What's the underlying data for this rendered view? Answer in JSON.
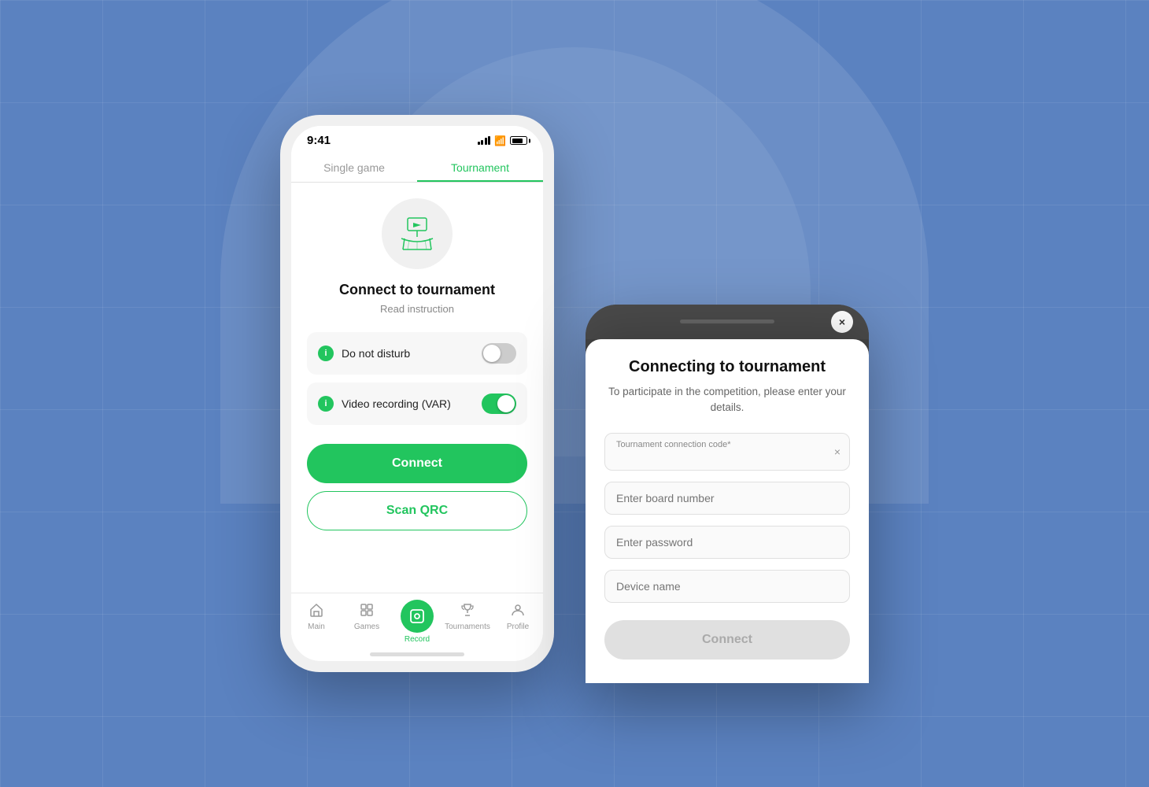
{
  "background": {
    "color": "#5b82c0"
  },
  "phone1": {
    "statusBar": {
      "time": "9:41"
    },
    "tabs": [
      {
        "label": "Single game",
        "active": false
      },
      {
        "label": "Tournament",
        "active": true
      }
    ],
    "heroTitle": "Connect to tournament",
    "heroSubtitle": "Read instruction",
    "toggles": [
      {
        "label": "Do not disturb",
        "on": false
      },
      {
        "label": "Video recording (VAR)",
        "on": true
      }
    ],
    "connectButton": "Connect",
    "scanButton": "Scan QRC",
    "navItems": [
      {
        "label": "Main",
        "icon": "home-icon",
        "active": false
      },
      {
        "label": "Games",
        "icon": "games-icon",
        "active": false
      },
      {
        "label": "Record",
        "icon": "record-icon",
        "active": true
      },
      {
        "label": "Tournaments",
        "icon": "tournaments-icon",
        "active": false
      },
      {
        "label": "Profile",
        "icon": "profile-icon",
        "active": false
      }
    ]
  },
  "modal": {
    "title": "Connecting to tournament",
    "description": "To participate in the competition, please enter your details.",
    "fields": [
      {
        "label": "Tournament connection code*",
        "placeholder": "",
        "value": "",
        "hasCursor": true,
        "hasClear": true
      },
      {
        "placeholder": "Enter board number",
        "label": "",
        "hasCursor": false,
        "hasClear": false
      },
      {
        "placeholder": "Enter password",
        "label": "",
        "hasCursor": false,
        "hasClear": false
      },
      {
        "placeholder": "Device name",
        "label": "",
        "hasCursor": false,
        "hasClear": false
      }
    ],
    "connectButton": "Connect",
    "closeLabel": "×"
  }
}
